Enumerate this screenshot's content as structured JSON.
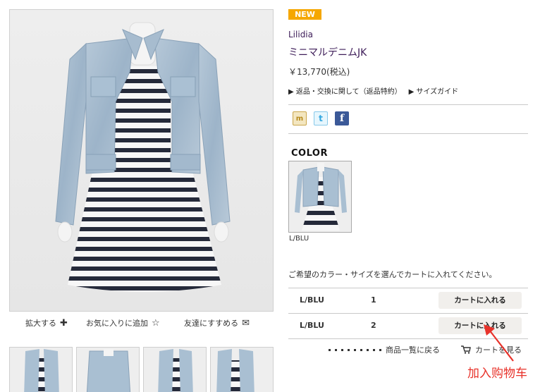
{
  "badge": "NEW",
  "brand": "Lilidia",
  "product_name": "ミニマルデニムJK",
  "price": "￥13,770(税込)",
  "links": {
    "returns": "返品・交換に関して（返品特約）",
    "size_guide": "サイズガイド"
  },
  "photo_actions": {
    "zoom": "拡大する",
    "favorite": "お気に入りに追加",
    "share": "友達にすすめる"
  },
  "social_icons": [
    "mixi-icon",
    "twitter-icon",
    "facebook-icon"
  ],
  "color_heading": "COLOR",
  "color_swatch_label": "L/BLU",
  "instruction": "ご希望のカラー・サイズを選んでカートに入れてください。",
  "sku_rows": [
    {
      "color": "L/BLU",
      "size": "1",
      "button": "カートに入れる"
    },
    {
      "color": "L/BLU",
      "size": "2",
      "button": "カートに入れる"
    }
  ],
  "bottom_links": {
    "back_to_list": "商品一覧に戻る",
    "view_cart": "カートを見る"
  },
  "annotation": "加入购物车",
  "colors": {
    "badge": "#f5a700",
    "title": "#3d1c58",
    "annotation": "#e8322a",
    "button_bg": "#f1efec"
  }
}
